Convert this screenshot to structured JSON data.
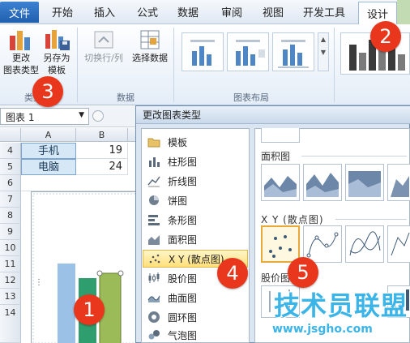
{
  "ribbon": {
    "file_tab": "文件",
    "tabs": [
      "开始",
      "插入",
      "公式",
      "数据",
      "审阅",
      "视图",
      "开发工具"
    ],
    "active_tab": "设计",
    "buttons": {
      "change_chart_type": "更改\n图表类型",
      "save_as_template": "另存为\n模板",
      "switch_row_col": "切换行/列",
      "select_data": "选择数据"
    },
    "groups": {
      "type": "类型",
      "data": "数据",
      "chart_layouts": "图表布局"
    }
  },
  "namebox": {
    "value": "图表 1"
  },
  "sheet": {
    "columns": [
      "A",
      "B"
    ],
    "rows": [
      {
        "num": "4",
        "label": "手机",
        "value": "19"
      },
      {
        "num": "5",
        "label": "电脑",
        "value": "24"
      },
      {
        "num": "6"
      },
      {
        "num": "7"
      },
      {
        "num": "8"
      },
      {
        "num": "9"
      },
      {
        "num": "10"
      },
      {
        "num": "11"
      },
      {
        "num": "12"
      },
      {
        "num": "13"
      },
      {
        "num": "14"
      }
    ]
  },
  "dialog": {
    "title": "更改图表类型",
    "chart_types": [
      {
        "label": "模板",
        "icon": "folder-icon"
      },
      {
        "label": "柱形图",
        "icon": "column-chart-icon"
      },
      {
        "label": "折线图",
        "icon": "line-chart-icon"
      },
      {
        "label": "饼图",
        "icon": "pie-chart-icon"
      },
      {
        "label": "条形图",
        "icon": "bar-chart-icon"
      },
      {
        "label": "面积图",
        "icon": "area-chart-icon"
      },
      {
        "label": "X Y (散点图)",
        "icon": "scatter-chart-icon",
        "selected": true
      },
      {
        "label": "股价图",
        "icon": "stock-chart-icon"
      },
      {
        "label": "曲面图",
        "icon": "surface-chart-icon"
      },
      {
        "label": "圆环图",
        "icon": "doughnut-chart-icon"
      },
      {
        "label": "气泡图",
        "icon": "bubble-chart-icon"
      }
    ],
    "sections": {
      "area": "面积图",
      "scatter": "X Y (散点图)",
      "stock": "股价图"
    }
  },
  "badges": [
    "1",
    "2",
    "3",
    "4",
    "5"
  ],
  "watermark": {
    "text": "技术员联盟",
    "url": "www.jsgho.com"
  },
  "colors": {
    "badge": "#e8371c",
    "accent": "#1f5fae",
    "selection": "#ffdf7a",
    "bar_blue": "#9cc1e6",
    "bar_green": "#2f9e6e",
    "bar_olive": "#9bbb59",
    "watermark": "#3bb4e8"
  }
}
